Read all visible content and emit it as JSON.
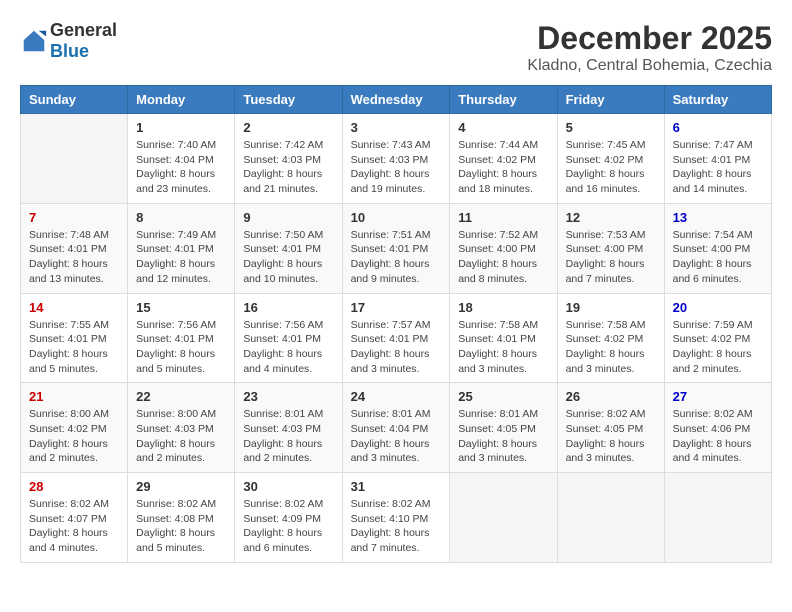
{
  "logo": {
    "general": "General",
    "blue": "Blue"
  },
  "title": "December 2025",
  "subtitle": "Kladno, Central Bohemia, Czechia",
  "days": [
    "Sunday",
    "Monday",
    "Tuesday",
    "Wednesday",
    "Thursday",
    "Friday",
    "Saturday"
  ],
  "weeks": [
    [
      {
        "num": "",
        "info": ""
      },
      {
        "num": "1",
        "info": "Sunrise: 7:40 AM\nSunset: 4:04 PM\nDaylight: 8 hours\nand 23 minutes."
      },
      {
        "num": "2",
        "info": "Sunrise: 7:42 AM\nSunset: 4:03 PM\nDaylight: 8 hours\nand 21 minutes."
      },
      {
        "num": "3",
        "info": "Sunrise: 7:43 AM\nSunset: 4:03 PM\nDaylight: 8 hours\nand 19 minutes."
      },
      {
        "num": "4",
        "info": "Sunrise: 7:44 AM\nSunset: 4:02 PM\nDaylight: 8 hours\nand 18 minutes."
      },
      {
        "num": "5",
        "info": "Sunrise: 7:45 AM\nSunset: 4:02 PM\nDaylight: 8 hours\nand 16 minutes."
      },
      {
        "num": "6",
        "info": "Sunrise: 7:47 AM\nSunset: 4:01 PM\nDaylight: 8 hours\nand 14 minutes."
      }
    ],
    [
      {
        "num": "7",
        "info": "Sunrise: 7:48 AM\nSunset: 4:01 PM\nDaylight: 8 hours\nand 13 minutes."
      },
      {
        "num": "8",
        "info": "Sunrise: 7:49 AM\nSunset: 4:01 PM\nDaylight: 8 hours\nand 12 minutes."
      },
      {
        "num": "9",
        "info": "Sunrise: 7:50 AM\nSunset: 4:01 PM\nDaylight: 8 hours\nand 10 minutes."
      },
      {
        "num": "10",
        "info": "Sunrise: 7:51 AM\nSunset: 4:01 PM\nDaylight: 8 hours\nand 9 minutes."
      },
      {
        "num": "11",
        "info": "Sunrise: 7:52 AM\nSunset: 4:00 PM\nDaylight: 8 hours\nand 8 minutes."
      },
      {
        "num": "12",
        "info": "Sunrise: 7:53 AM\nSunset: 4:00 PM\nDaylight: 8 hours\nand 7 minutes."
      },
      {
        "num": "13",
        "info": "Sunrise: 7:54 AM\nSunset: 4:00 PM\nDaylight: 8 hours\nand 6 minutes."
      }
    ],
    [
      {
        "num": "14",
        "info": "Sunrise: 7:55 AM\nSunset: 4:01 PM\nDaylight: 8 hours\nand 5 minutes."
      },
      {
        "num": "15",
        "info": "Sunrise: 7:56 AM\nSunset: 4:01 PM\nDaylight: 8 hours\nand 5 minutes."
      },
      {
        "num": "16",
        "info": "Sunrise: 7:56 AM\nSunset: 4:01 PM\nDaylight: 8 hours\nand 4 minutes."
      },
      {
        "num": "17",
        "info": "Sunrise: 7:57 AM\nSunset: 4:01 PM\nDaylight: 8 hours\nand 3 minutes."
      },
      {
        "num": "18",
        "info": "Sunrise: 7:58 AM\nSunset: 4:01 PM\nDaylight: 8 hours\nand 3 minutes."
      },
      {
        "num": "19",
        "info": "Sunrise: 7:58 AM\nSunset: 4:02 PM\nDaylight: 8 hours\nand 3 minutes."
      },
      {
        "num": "20",
        "info": "Sunrise: 7:59 AM\nSunset: 4:02 PM\nDaylight: 8 hours\nand 2 minutes."
      }
    ],
    [
      {
        "num": "21",
        "info": "Sunrise: 8:00 AM\nSunset: 4:02 PM\nDaylight: 8 hours\nand 2 minutes."
      },
      {
        "num": "22",
        "info": "Sunrise: 8:00 AM\nSunset: 4:03 PM\nDaylight: 8 hours\nand 2 minutes."
      },
      {
        "num": "23",
        "info": "Sunrise: 8:01 AM\nSunset: 4:03 PM\nDaylight: 8 hours\nand 2 minutes."
      },
      {
        "num": "24",
        "info": "Sunrise: 8:01 AM\nSunset: 4:04 PM\nDaylight: 8 hours\nand 3 minutes."
      },
      {
        "num": "25",
        "info": "Sunrise: 8:01 AM\nSunset: 4:05 PM\nDaylight: 8 hours\nand 3 minutes."
      },
      {
        "num": "26",
        "info": "Sunrise: 8:02 AM\nSunset: 4:05 PM\nDaylight: 8 hours\nand 3 minutes."
      },
      {
        "num": "27",
        "info": "Sunrise: 8:02 AM\nSunset: 4:06 PM\nDaylight: 8 hours\nand 4 minutes."
      }
    ],
    [
      {
        "num": "28",
        "info": "Sunrise: 8:02 AM\nSunset: 4:07 PM\nDaylight: 8 hours\nand 4 minutes."
      },
      {
        "num": "29",
        "info": "Sunrise: 8:02 AM\nSunset: 4:08 PM\nDaylight: 8 hours\nand 5 minutes."
      },
      {
        "num": "30",
        "info": "Sunrise: 8:02 AM\nSunset: 4:09 PM\nDaylight: 8 hours\nand 6 minutes."
      },
      {
        "num": "31",
        "info": "Sunrise: 8:02 AM\nSunset: 4:10 PM\nDaylight: 8 hours\nand 7 minutes."
      },
      {
        "num": "",
        "info": ""
      },
      {
        "num": "",
        "info": ""
      },
      {
        "num": "",
        "info": ""
      }
    ]
  ]
}
